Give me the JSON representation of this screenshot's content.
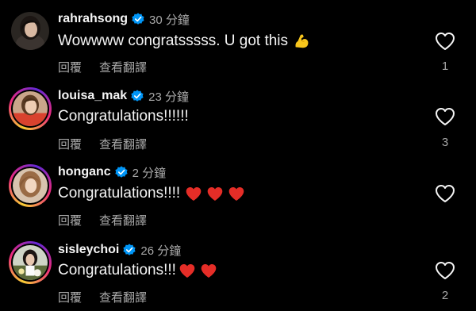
{
  "comments": [
    {
      "username": "rahrahsong",
      "verified": true,
      "time": "30 分鐘",
      "text": "Wowwww congratsssss. U got this",
      "emojis": [
        "flexed-biceps"
      ],
      "reply_label": "回覆",
      "translate_label": "查看翻譯",
      "likes": "1",
      "story_ring": false
    },
    {
      "username": "louisa_mak",
      "verified": true,
      "time": "23 分鐘",
      "text": "Congratulations!!!!!!",
      "emojis": [],
      "reply_label": "回覆",
      "translate_label": "查看翻譯",
      "likes": "3",
      "story_ring": true
    },
    {
      "username": "honganc",
      "verified": true,
      "time": "2 分鐘",
      "text": "Congratulations!!!!",
      "emojis": [
        "red-heart",
        "red-heart",
        "red-heart"
      ],
      "reply_label": "回覆",
      "translate_label": "查看翻譯",
      "likes": "",
      "story_ring": true
    },
    {
      "username": "sisleychoi",
      "verified": true,
      "time": "26 分鐘",
      "text": "Congratulations!!!",
      "emojis": [
        "red-heart",
        "red-heart"
      ],
      "reply_label": "回覆",
      "translate_label": "查看翻譯",
      "likes": "2",
      "story_ring": true
    }
  ],
  "colors": {
    "background": "#000000",
    "text": "#f5f5f5",
    "secondary": "#a8a8a8",
    "verified_badge": "#0095f6",
    "heart_emoji": "#e52d27",
    "flex_emoji": "#f7c51c"
  }
}
